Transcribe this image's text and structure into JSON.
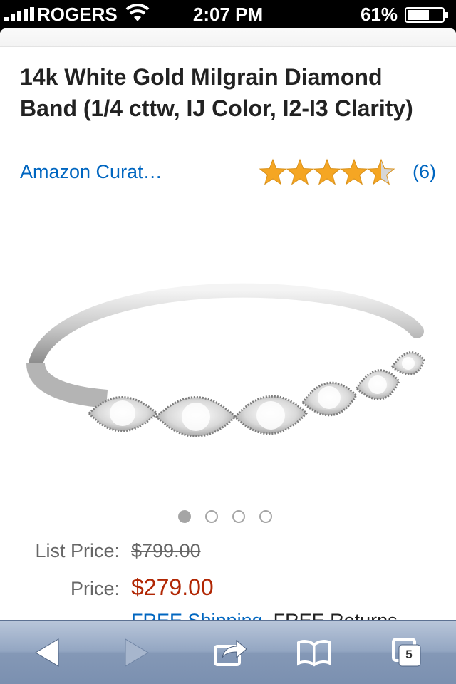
{
  "status_bar": {
    "carrier": "ROGERS",
    "time": "2:07 PM",
    "battery": "61%"
  },
  "product": {
    "title": "14k White Gold Milgrain Diamond Band (1/4 cttw, IJ Color, I2-I3 Clarity)",
    "brand": "Amazon Curat…",
    "rating": 4.5,
    "rating_max": 5,
    "review_count": "(6)",
    "image_count": 4,
    "active_image": 0,
    "list_price_label": "List Price:",
    "list_price": "$799.00",
    "price_label": "Price:",
    "price": "$279.00",
    "shipping_free": "FREE Shipping",
    "returns_free": ". FREE Returns"
  },
  "toolbar": {
    "open_pages": "5",
    "icons": [
      "back-icon",
      "forward-icon",
      "share-icon",
      "bookmarks-icon",
      "pages-icon"
    ]
  },
  "colors": {
    "link": "#0066c0",
    "price": "#b12704",
    "star": "#f5a623",
    "toolbar": "#8ea1bf"
  }
}
